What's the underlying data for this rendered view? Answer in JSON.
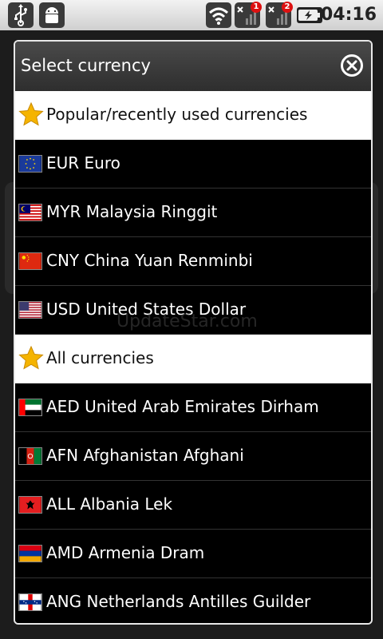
{
  "status_bar": {
    "time": "04:16",
    "signal1_badge": "1",
    "signal2_badge": "2",
    "icons": [
      "usb-icon",
      "android-debug-icon",
      "wifi-icon",
      "signal-icon",
      "signal-icon",
      "battery-charging-icon"
    ]
  },
  "dialog": {
    "title": "Select currency",
    "close_icon": "close-circle-icon"
  },
  "sections": {
    "popular": "Popular/recently used currencies",
    "all": "All currencies"
  },
  "popular_items": [
    "EUR Euro",
    "MYR Malaysia Ringgit",
    "CNY China Yuan Renminbi",
    "USD United States Dollar"
  ],
  "all_items": [
    "AED United Arab Emirates Dirham",
    "AFN Afghanistan Afghani",
    "ALL Albania Lek",
    "AMD Armenia Dram",
    "ANG Netherlands Antilles Guilder"
  ],
  "watermark": "UpdateStar.com",
  "colors": {
    "section_bg": "#ffffff",
    "item_bg": "#000000",
    "star": "#f5b400"
  }
}
